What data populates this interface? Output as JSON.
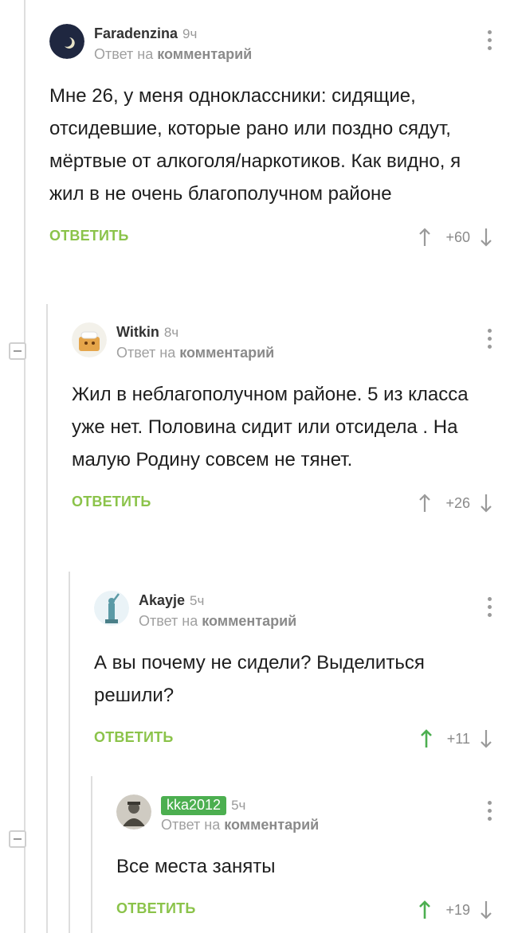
{
  "reply_to": {
    "prefix": "Ответ на",
    "link": "комментарий"
  },
  "reply_label": "ОТВЕТИТЬ",
  "comments": [
    {
      "author": "Faradenzina",
      "time": "9ч",
      "text": "Мне 26, у меня одноклассники: сидящие, отсидевшие, которые рано или поздно сядут, мёртвые от алкоголя/наркотиков. Как видно, я жил в не очень благополучном районе",
      "score": "+60"
    },
    {
      "author": "Witkin",
      "time": "8ч",
      "text": "Жил в неблагополучном районе. 5 из класса уже нет. Половина сидит или отсидела . На малую Родину совсем не тянет.",
      "score": "+26"
    },
    {
      "author": "Akayje",
      "time": "5ч",
      "text": "А вы почему не сидели? Выделиться решили?",
      "score": "+11"
    },
    {
      "author": "kka2012",
      "time": "5ч",
      "text": "Все места заняты",
      "score": "+19"
    }
  ],
  "colors": {
    "accent_green": "#8bc34a",
    "upvoted_green": "#4caf50",
    "badge_green": "#4caf50",
    "muted": "#9a9a9a"
  }
}
